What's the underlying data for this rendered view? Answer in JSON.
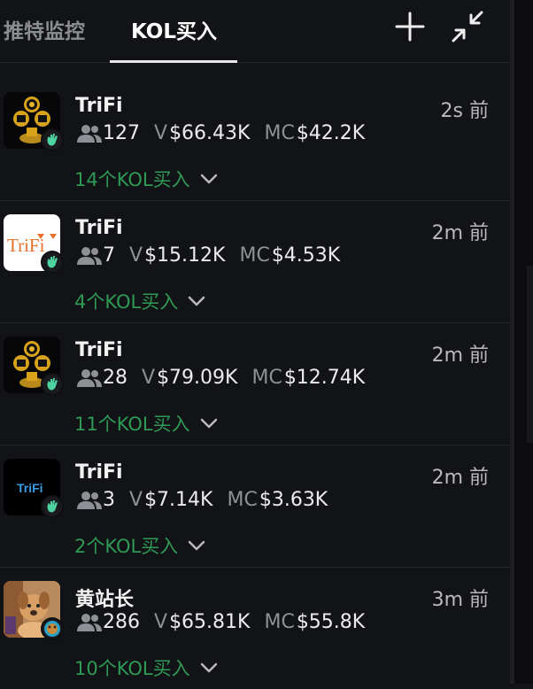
{
  "tabs": [
    {
      "label": "推特监控",
      "active": false
    },
    {
      "label": "KOL买入",
      "active": true
    }
  ],
  "header": {
    "add_icon": "plus-icon",
    "minimize_icon": "minimize-icon"
  },
  "colors": {
    "background": "#121316",
    "kol_green": "#2e9a55",
    "text_primary": "#f2f2f2",
    "text_muted": "#8f9096"
  },
  "items": [
    {
      "name": "TriFi",
      "time": "2s 前",
      "holders": "127",
      "v_label": "V",
      "volume": "$66.43K",
      "mc_label": "MC",
      "mc": "$42.2K",
      "kol": "14个KOL买入",
      "avatar": "trifi-coins-logo"
    },
    {
      "name": "TriFi",
      "time": "2m 前",
      "holders": "7",
      "v_label": "V",
      "volume": "$15.12K",
      "mc_label": "MC",
      "mc": "$4.53K",
      "kol": "4个KOL买入",
      "avatar": "trifi-text-logo",
      "avatar_text": "TriFi"
    },
    {
      "name": "TriFi",
      "time": "2m 前",
      "holders": "28",
      "v_label": "V",
      "volume": "$79.09K",
      "mc_label": "MC",
      "mc": "$12.74K",
      "kol": "11个KOL买入",
      "avatar": "trifi-coins-logo"
    },
    {
      "name": "TriFi",
      "time": "2m 前",
      "holders": "3",
      "v_label": "V",
      "volume": "$7.14K",
      "mc_label": "MC",
      "mc": "$3.63K",
      "kol": "2个KOL买入",
      "avatar": "trifi-dark-logo",
      "avatar_text": "TriFi"
    },
    {
      "name": "黄站长",
      "time": "3m 前",
      "holders": "286",
      "v_label": "V",
      "volume": "$65.81K",
      "mc_label": "MC",
      "mc": "$55.8K",
      "kol": "10个KOL买入",
      "avatar": "dog-photo"
    }
  ]
}
